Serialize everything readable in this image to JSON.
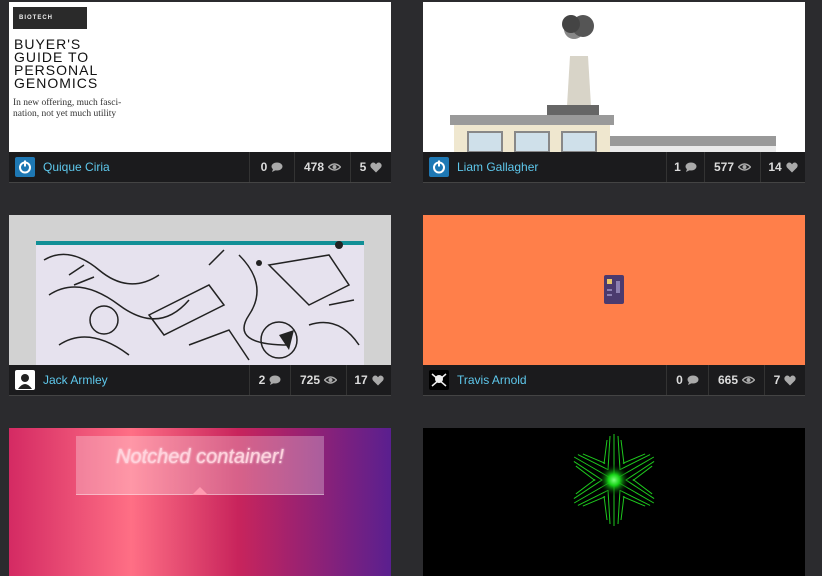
{
  "cards": [
    {
      "author": "Quique Ciria",
      "comments": "0",
      "views": "478",
      "likes": "5",
      "thumb": {
        "tag": "BIOTECH",
        "title_lines": [
          "BUYER'S",
          "GUIDE TO",
          "PERSONAL",
          "GENOMICS"
        ],
        "subtitle": "In new offering, much fasci-nation, not yet much utility"
      }
    },
    {
      "author": "Liam Gallagher",
      "comments": "1",
      "views": "577",
      "likes": "14"
    },
    {
      "author": "Jack Armley",
      "comments": "2",
      "views": "725",
      "likes": "17"
    },
    {
      "author": "Travis Arnold",
      "comments": "0",
      "views": "665",
      "likes": "7",
      "thumb_bg": "#ff7f4a"
    },
    {
      "thumb": {
        "text": "Notched container!"
      }
    },
    {}
  ],
  "icons": {
    "comment": "comment-icon",
    "view": "eye-icon",
    "like": "heart-icon"
  },
  "colors": {
    "background": "#2b2b2e",
    "meta_bar": "#1b1b1d",
    "author_link": "#5ec8ec",
    "orange": "#ff7f4a"
  }
}
